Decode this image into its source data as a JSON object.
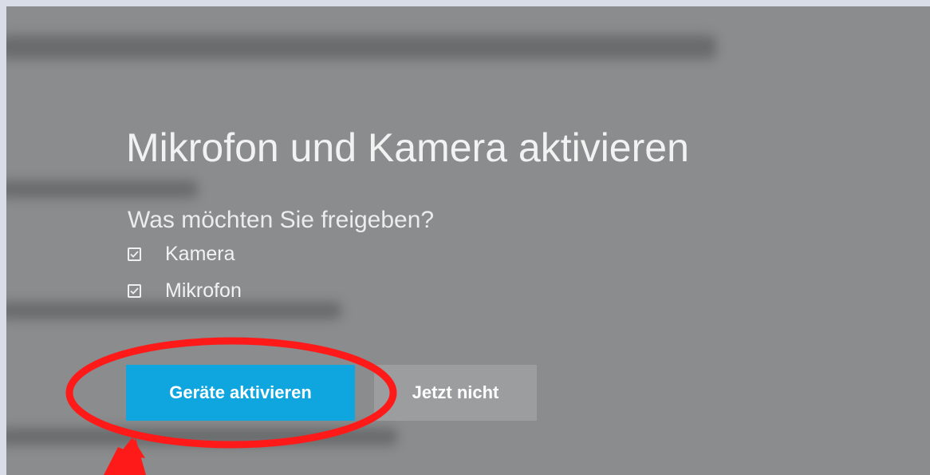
{
  "dialog": {
    "title": "Mikrofon und Kamera aktivieren",
    "subtitle": "Was möchten Sie freigeben?",
    "options": [
      {
        "label": "Kamera",
        "checked": true
      },
      {
        "label": "Mikrofon",
        "checked": true
      }
    ],
    "primary_button": "Geräte aktivieren",
    "secondary_button": "Jetzt nicht"
  },
  "colors": {
    "overlay_bg": "#8a8c8d",
    "primary_button": "#0fa6e0",
    "secondary_button": "#9b9d9e",
    "annotation_red": "#ff1a1a"
  },
  "annotation": {
    "shape": "ellipse-highlight",
    "target": "primary_button",
    "arrow_icon": "red-arrow-icon"
  }
}
